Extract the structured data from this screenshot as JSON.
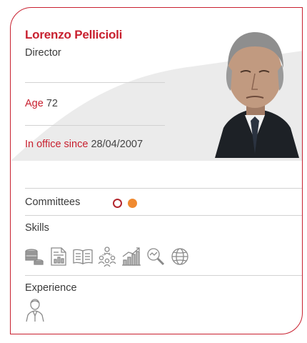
{
  "profile": {
    "name": "Lorenzo Pellicioli",
    "role": "Director",
    "age_label": "Age",
    "age_value": "72",
    "office_label": "In office since",
    "office_value": "28/04/2007"
  },
  "sections": {
    "committees_label": "Committees",
    "skills_label": "Skills",
    "experience_label": "Experience"
  },
  "committees": [
    "outline-circle",
    "filled-circle"
  ],
  "skills": [
    "finance-coins-icon",
    "report-chart-icon",
    "open-book-icon",
    "team-network-icon",
    "growth-chart-icon",
    "magnifier-analysis-icon",
    "globe-icon"
  ],
  "experience": [
    "executive-person-icon"
  ],
  "colors": {
    "accent": "#c8202f",
    "committee_outline": "#b3262e",
    "committee_fill": "#f08a30",
    "icon_stroke": "#8a8a8a"
  }
}
